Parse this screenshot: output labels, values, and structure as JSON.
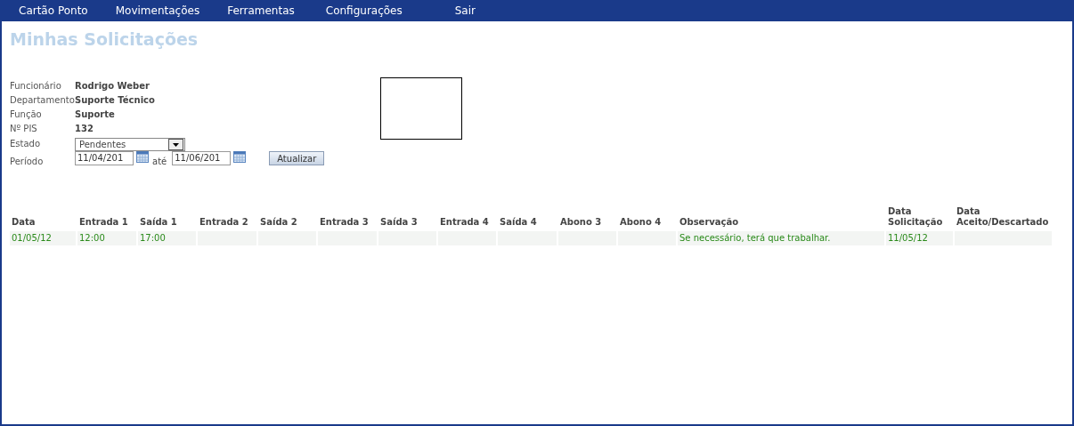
{
  "menu": [
    {
      "label": "Cartão Ponto"
    },
    {
      "label": "Movimentações"
    },
    {
      "label": "Ferramentas"
    },
    {
      "label": "Configurações"
    },
    {
      "label": "Sair"
    }
  ],
  "title": "Minhas Solicitações",
  "info": [
    {
      "label": "Funcionário",
      "value": "Rodrigo Weber"
    },
    {
      "label": "Departamento",
      "value": "Suporte Técnico"
    },
    {
      "label": "Função",
      "value": "Suporte"
    },
    {
      "label": "Nº PIS",
      "value": "132"
    }
  ],
  "estado": {
    "label": "Estado",
    "value": "Pendentes"
  },
  "periodo": {
    "label": "Período",
    "from": "11/04/201",
    "separator": "até",
    "to": "11/06/201"
  },
  "update_button": "Atualizar",
  "table": {
    "columns": [
      "Data",
      "Entrada 1",
      "Saída 1",
      "Entrada 2",
      "Saída 2",
      "Entrada 3",
      "Saída 3",
      "Entrada 4",
      "Saída 4",
      "Abono 3",
      "Abono 4",
      "Observação",
      "Data Solicitação",
      "Data Aceito/Descartado"
    ],
    "rows": [
      {
        "cells": [
          "01/05/12",
          "12:00",
          "17:00",
          null,
          null,
          null,
          null,
          null,
          null,
          null,
          null,
          "Se necessário, terá que trabalhar.",
          "11/05/12",
          null
        ]
      }
    ]
  }
}
